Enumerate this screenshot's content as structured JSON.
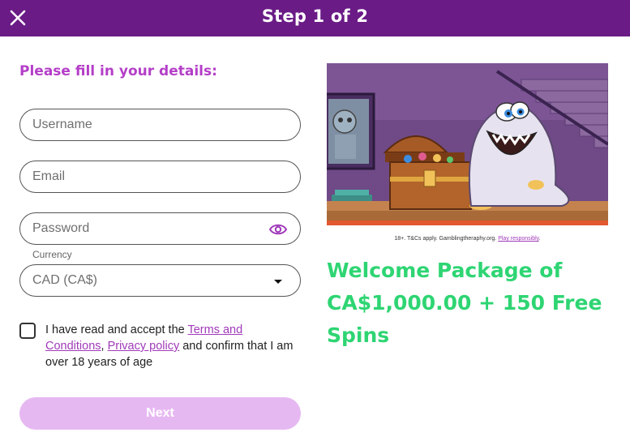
{
  "header": {
    "title": "Step 1 of 2",
    "close_icon": "close-icon"
  },
  "form": {
    "title": "Please fill in your details:",
    "username_placeholder": "Username",
    "email_placeholder": "Email",
    "password_placeholder": "Password",
    "password_toggle_icon": "eye-icon",
    "currency_label": "Currency",
    "currency_value": "CAD (CA$)",
    "consent": {
      "text_before": "I have read and accept the ",
      "terms_link": "Terms and Conditions",
      "comma": ",",
      "privacy_link": "Privacy policy",
      "text_after": " and confirm that I am over 18 years of age"
    },
    "next_label": "Next"
  },
  "promo": {
    "terms_text": "18+. T&Cs apply. Gamblingtheraphy.org. ",
    "terms_link": "Play responsibly",
    "terms_end": ".",
    "headline": "Welcome Package of CA$1,000.00 + 150 Free Spins"
  },
  "colors": {
    "header_bg": "#6a1b86",
    "accent_purple": "#b43ec8",
    "next_button_bg": "#e6b8f2",
    "headline_green": "#2ed573"
  }
}
